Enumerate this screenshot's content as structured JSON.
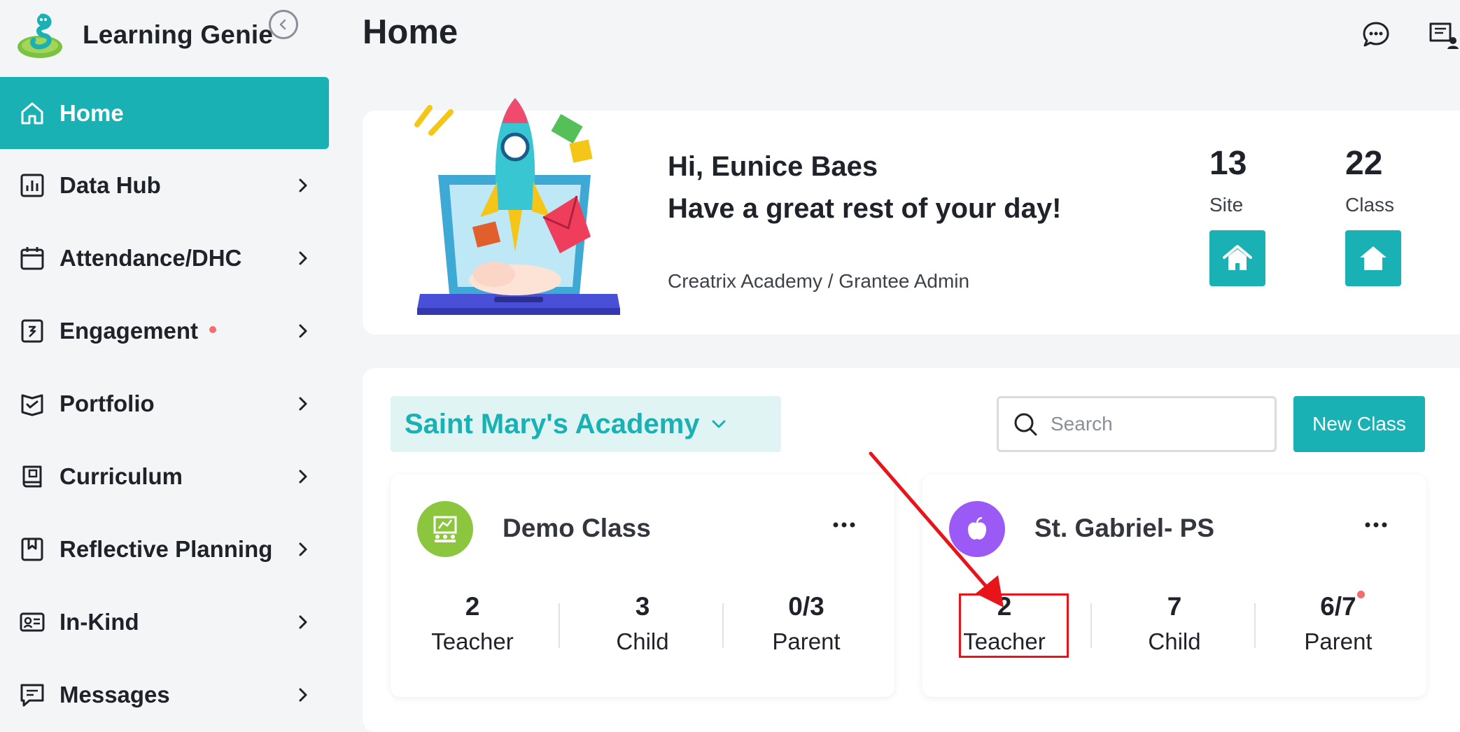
{
  "app": {
    "name": "Learning Genie"
  },
  "sidebar": {
    "items": [
      {
        "label": "Home",
        "icon": "home-icon",
        "active": true
      },
      {
        "label": "Data Hub",
        "icon": "bar-chart-icon"
      },
      {
        "label": "Attendance/DHC",
        "icon": "calendar-icon"
      },
      {
        "label": "Engagement",
        "icon": "engagement-icon",
        "has_notification_dot": true
      },
      {
        "label": "Portfolio",
        "icon": "portfolio-icon"
      },
      {
        "label": "Curriculum",
        "icon": "book-icon"
      },
      {
        "label": "Reflective Planning",
        "icon": "bookmark-book-icon"
      },
      {
        "label": "In-Kind",
        "icon": "id-card-icon"
      },
      {
        "label": "Messages",
        "icon": "message-square-icon"
      }
    ]
  },
  "header": {
    "title": "Home",
    "icons": [
      "chat-bubble-icon",
      "contact-card-icon"
    ]
  },
  "welcome": {
    "greeting": "Hi, Eunice Baes",
    "message": "Have a great rest of your day!",
    "org_role": "Creatrix Academy / Grantee Admin",
    "stats": [
      {
        "value": "13",
        "label": "Site",
        "icon": "house-icon"
      },
      {
        "value": "22",
        "label": "Class",
        "icon": "house-icon"
      }
    ]
  },
  "classes": {
    "site_selector": "Saint Mary's Academy",
    "search_placeholder": "Search",
    "new_class_label": "New Class",
    "cards": [
      {
        "name": "Demo Class",
        "avatar_icon": "classroom-icon",
        "avatar_color": "#8cc63f",
        "stats": [
          {
            "value": "2",
            "label": "Teacher"
          },
          {
            "value": "3",
            "label": "Child"
          },
          {
            "value": "0/3",
            "label": "Parent"
          }
        ]
      },
      {
        "name": "St. Gabriel- PS",
        "avatar_icon": "apple-icon",
        "avatar_color": "#9b59f5",
        "stats": [
          {
            "value": "2",
            "label": "Teacher"
          },
          {
            "value": "7",
            "label": "Child"
          },
          {
            "value": "6/7",
            "label": "Parent",
            "has_notification_dot": true
          }
        ]
      }
    ]
  },
  "colors": {
    "accent": "#19b1b4",
    "accent_light": "#e0f4f4",
    "annotation": "#e8141a",
    "notification": "#f56c6c"
  }
}
